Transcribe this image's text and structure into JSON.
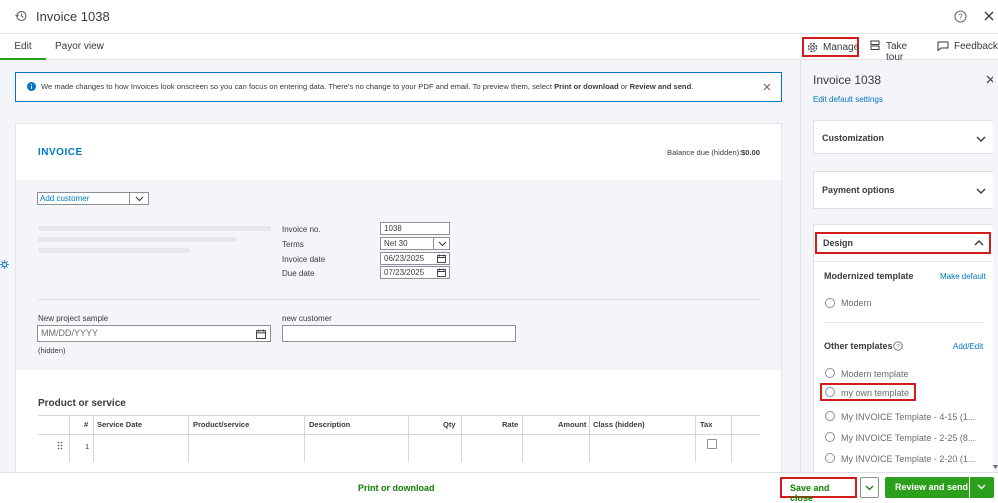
{
  "header": {
    "title": "Invoice 1038"
  },
  "tabs": [
    {
      "label": "Edit"
    },
    {
      "label": "Payor view"
    }
  ],
  "toolbar": {
    "manage": "Manage",
    "take_tour": "Take tour",
    "feedback": "Feedback"
  },
  "notice": {
    "text_start": "We made changes to how Invoices look onscreen so you can focus on entering data. There's no change to your PDF and email. To preview them, select ",
    "print_link": "Print or download",
    "or": " or ",
    "review_link": "Review and send",
    "end": "."
  },
  "invoice": {
    "heading": "INVOICE",
    "balance_label": "Balance due (hidden):",
    "balance_value": "$0.00",
    "customer_placeholder": "Add customer",
    "invoice_no_label": "Invoice no.",
    "invoice_no": "1038",
    "terms_label": "Terms",
    "terms": "Net 30",
    "invoice_date_label": "Invoice date",
    "invoice_date": "06/23/2025",
    "due_date_label": "Due date",
    "due_date": "07/23/2025",
    "project_label": "New project sample",
    "project_placeholder": "MM/DD/YYYY",
    "hidden_note": "(hidden)",
    "new_customer_label": "new customer",
    "product_heading": "Product or service",
    "columns": [
      "#",
      "Service Date",
      "Product/service",
      "Description",
      "Qty",
      "Rate",
      "Amount",
      "Class (hidden)",
      "Tax"
    ],
    "row_number": "1"
  },
  "side": {
    "title": "Invoice 1038",
    "edit_default": "Edit default settings",
    "customization": "Customization",
    "payment_options": "Payment options",
    "design": "Design",
    "modernized_template": "Modernized template",
    "make_default": "Make default",
    "modern": "Modern",
    "other_templates": "Other templates",
    "add_edit": "Add/Edit",
    "templates": [
      "Modern template",
      "my own template",
      "My INVOICE Template - 4-15 (1...",
      "My INVOICE Template - 2-25 (8...",
      "My INVOICE Template - 2-20 (1..."
    ]
  },
  "footer": {
    "print": "Print or download",
    "save_close": "Save and close",
    "review_send": "Review and send"
  },
  "colors": {
    "green": "#2ca01c",
    "blue": "#0077c5",
    "red_highlight": "#d21c1c",
    "link_green": "#108000"
  }
}
